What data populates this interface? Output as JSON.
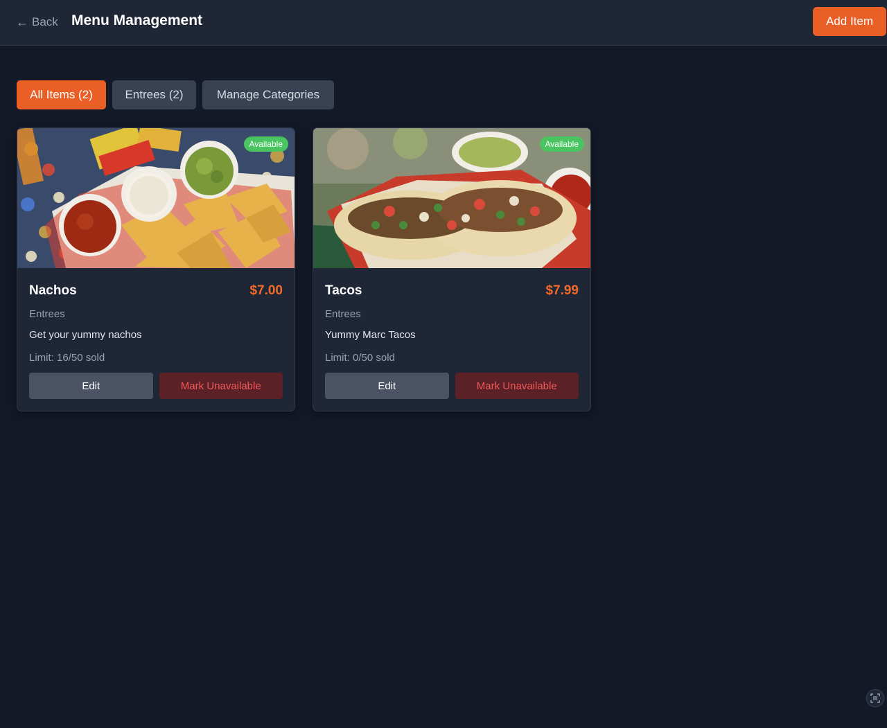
{
  "header": {
    "back_label": "Back",
    "title": "Menu Management",
    "add_label": "Add Item"
  },
  "tabs": [
    {
      "label": "All Items (2)",
      "active": true
    },
    {
      "label": "Entrees (2)",
      "active": false
    },
    {
      "label": "Manage Categories",
      "active": false
    }
  ],
  "items": [
    {
      "name": "Nachos",
      "price": "$7.00",
      "category": "Entrees",
      "description": "Get your yummy nachos",
      "limit": "Limit: 16/50 sold",
      "status": "Available",
      "edit_label": "Edit",
      "unavailable_label": "Mark Unavailable"
    },
    {
      "name": "Tacos",
      "price": "$7.99",
      "category": "Entrees",
      "description": "Yummy Marc Tacos",
      "limit": "Limit: 0/50 sold",
      "status": "Available",
      "edit_label": "Edit",
      "unavailable_label": "Mark Unavailable"
    }
  ],
  "colors": {
    "accent": "#ea5f25",
    "price": "#f06a2b",
    "available": "#4ac461",
    "danger_text": "#ef5a5a",
    "background": "#141927",
    "card": "#1f2636"
  },
  "icons": {
    "back": "arrow-left-icon",
    "scan": "scan-icon"
  }
}
